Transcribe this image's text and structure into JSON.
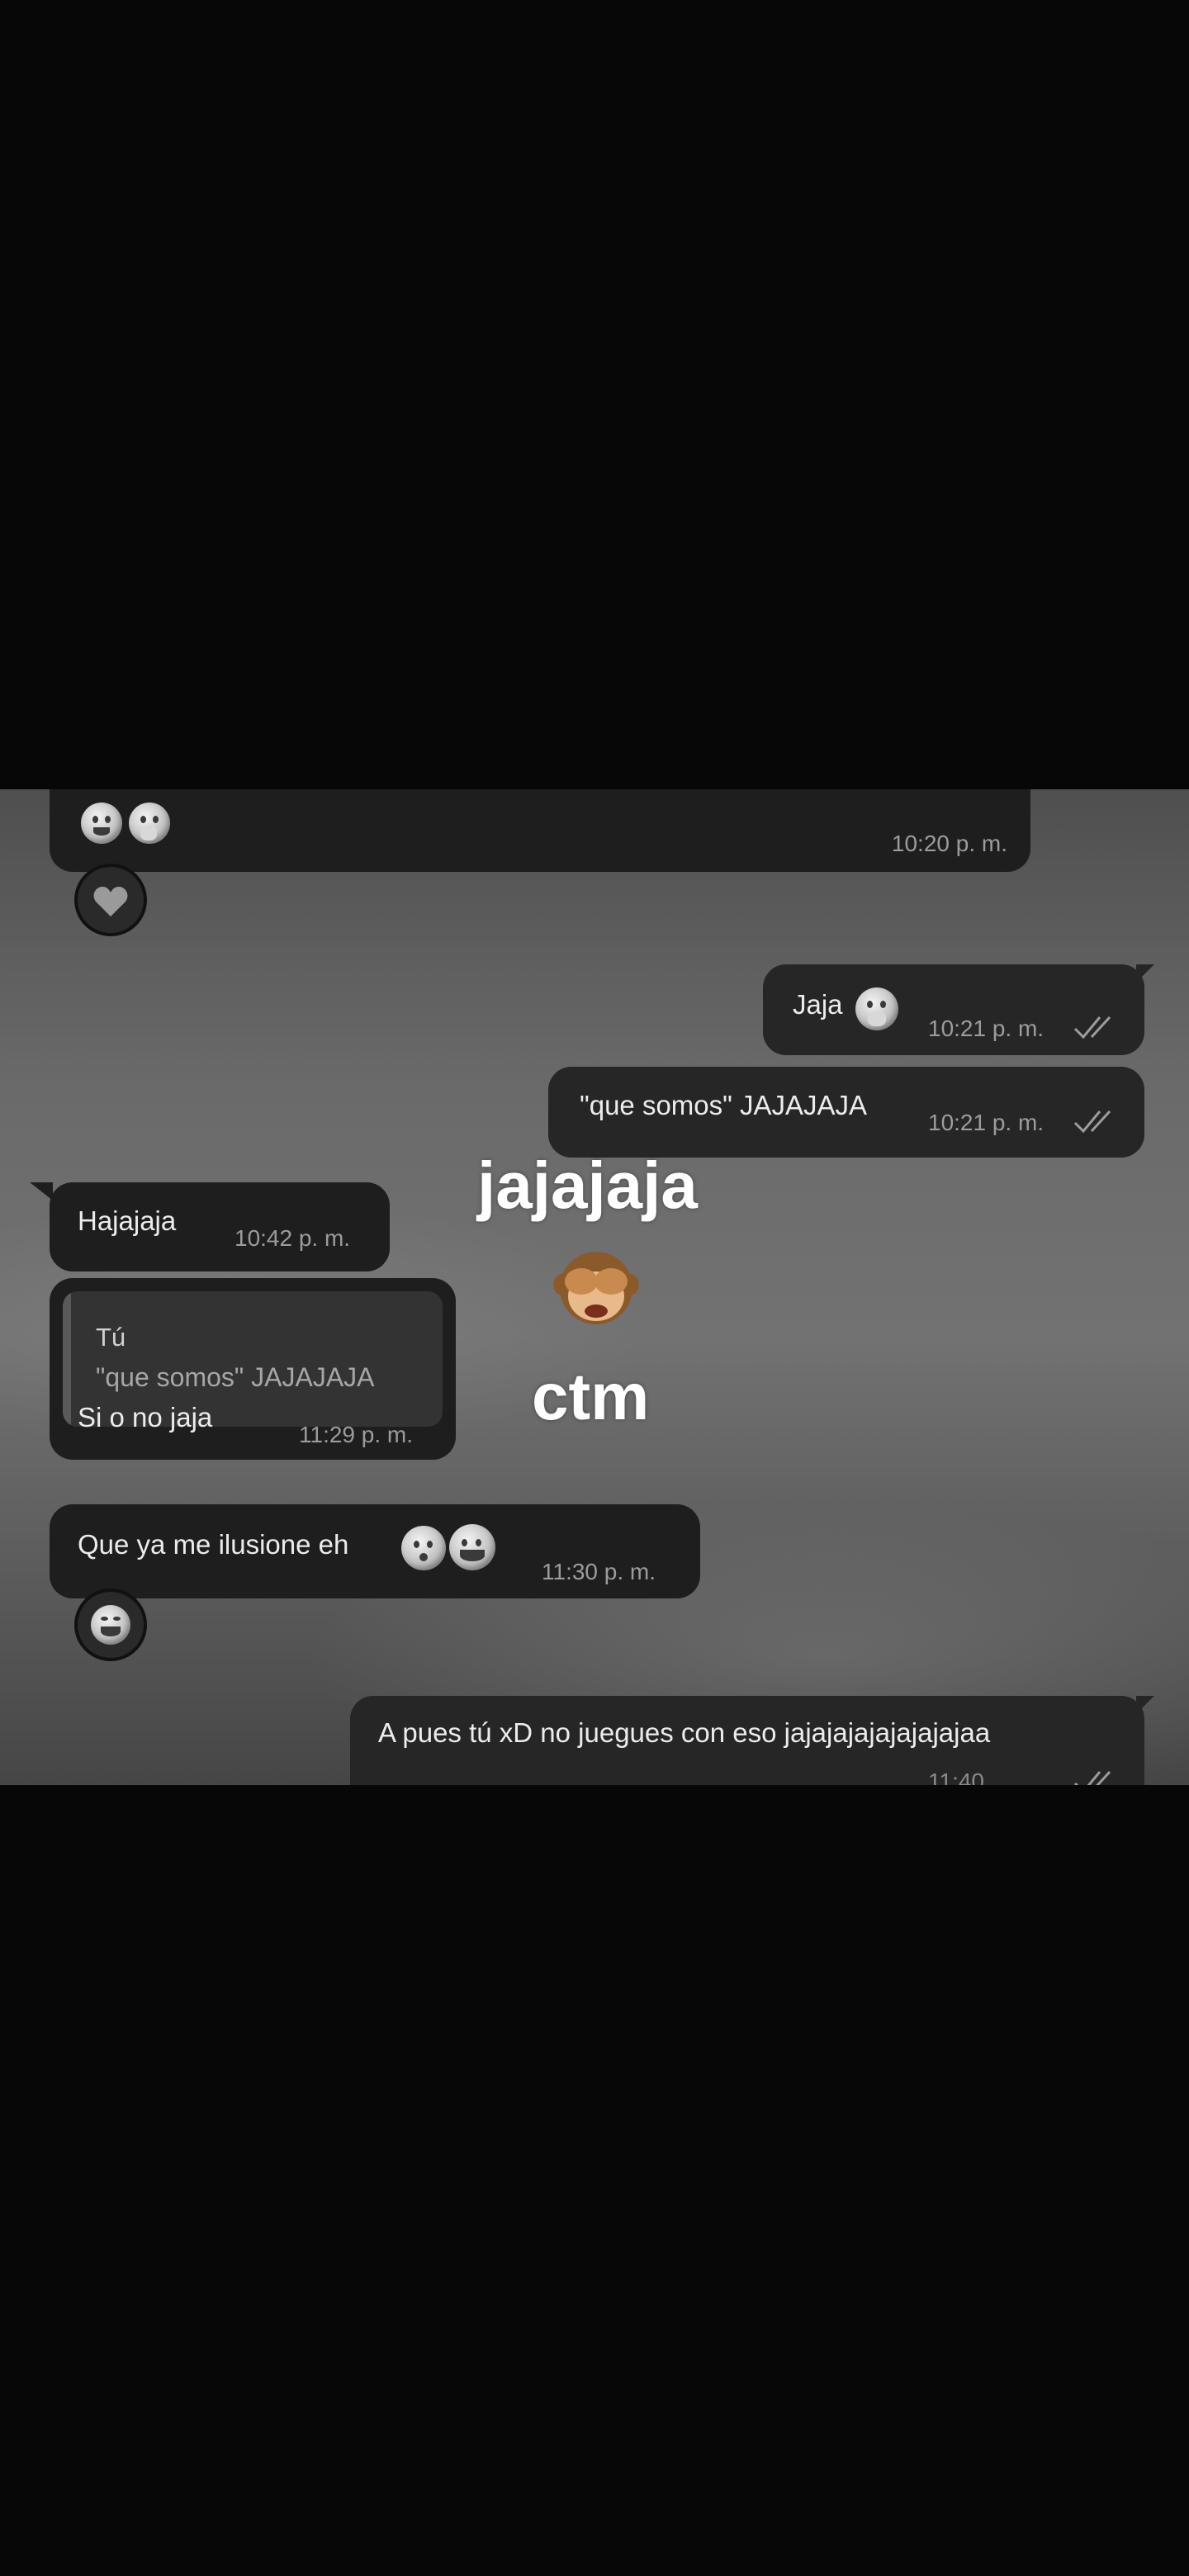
{
  "messages": {
    "m1": {
      "time": "10:20 p. m.",
      "emojis": [
        "drooling-face-icon",
        "shushing-face-icon"
      ],
      "reaction": "heart-icon"
    },
    "m2": {
      "text": "Jaja",
      "emoji": "shushing-face-icon",
      "time": "10:21 p. m."
    },
    "m3": {
      "text": "\"que somos\" JAJAJAJA",
      "time": "10:21 p. m."
    },
    "m4": {
      "text": "Hajajaja",
      "time": "10:42 p. m."
    },
    "m5": {
      "reply_author": "Tú",
      "reply_text": "\"que somos\" JAJAJAJA",
      "text": "Si o no jaja",
      "time": "11:29 p. m."
    },
    "m6": {
      "text": "Que ya me ilusione eh",
      "emojis": [
        "kissing-face-icon",
        "grinning-sweat-face-icon"
      ],
      "time": "11:30 p. m.",
      "reaction": "tears-of-joy-icon"
    },
    "m7": {
      "text": "A pues tú xD no juegues con eso jajajajajajajajajaa",
      "time": "11:40"
    }
  },
  "overlay": {
    "line1": "jajajaja",
    "emoji": "see-no-evil-monkey-icon",
    "line2": "ctm"
  },
  "colors": {
    "incoming_bubble": "#1e1e1e",
    "outgoing_bubble": "#262626",
    "timestamp": "#9c9c9c",
    "background_top": "#070707"
  }
}
